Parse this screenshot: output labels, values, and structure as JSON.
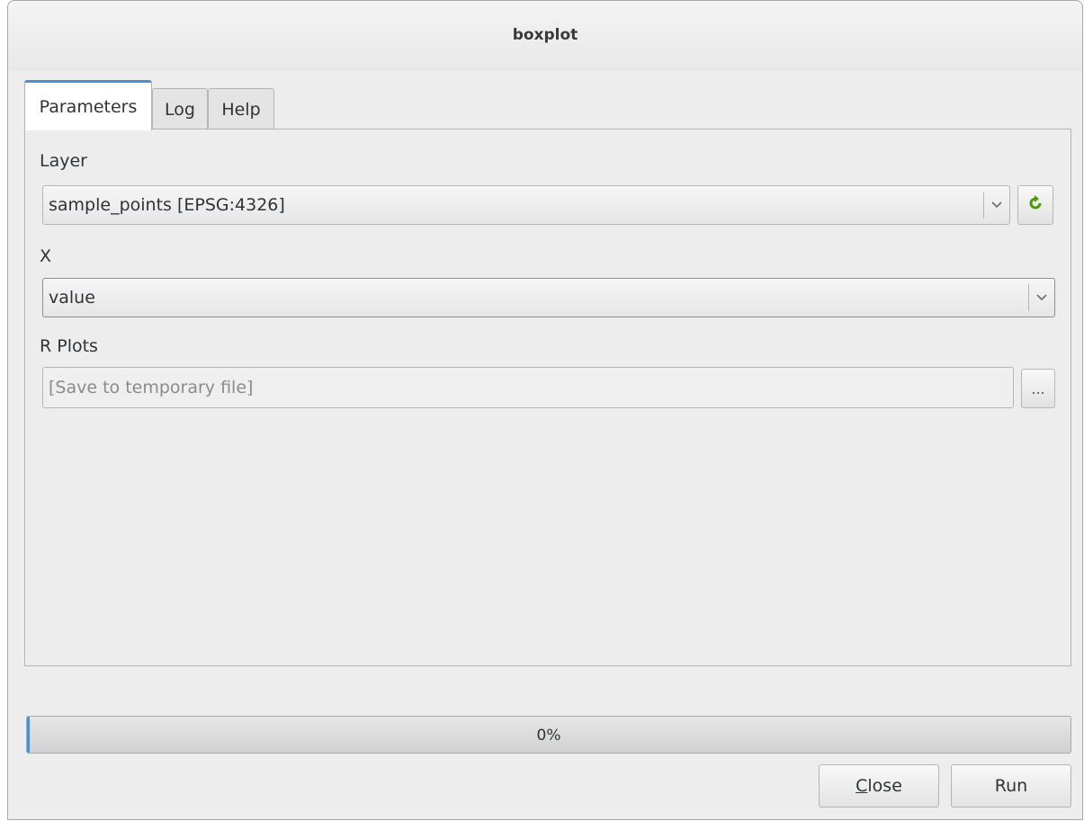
{
  "window": {
    "title": "boxplot"
  },
  "tabs": [
    {
      "label": "Parameters",
      "active": true
    },
    {
      "label": "Log",
      "active": false
    },
    {
      "label": "Help",
      "active": false
    }
  ],
  "params": {
    "layer": {
      "label": "Layer",
      "value": "sample_points [EPSG:4326]"
    },
    "x": {
      "label": "X",
      "value": "value"
    },
    "r_plots": {
      "label": "R Plots",
      "placeholder": "[Save to temporary file]",
      "browse_label": "..."
    }
  },
  "progress": {
    "value_percent": 0,
    "text": "0%"
  },
  "buttons": {
    "close_mnemonic": "C",
    "close_rest": "lose",
    "run": "Run"
  },
  "colors": {
    "accent": "#4a90d9",
    "refresh_icon": "#4e9a06"
  }
}
